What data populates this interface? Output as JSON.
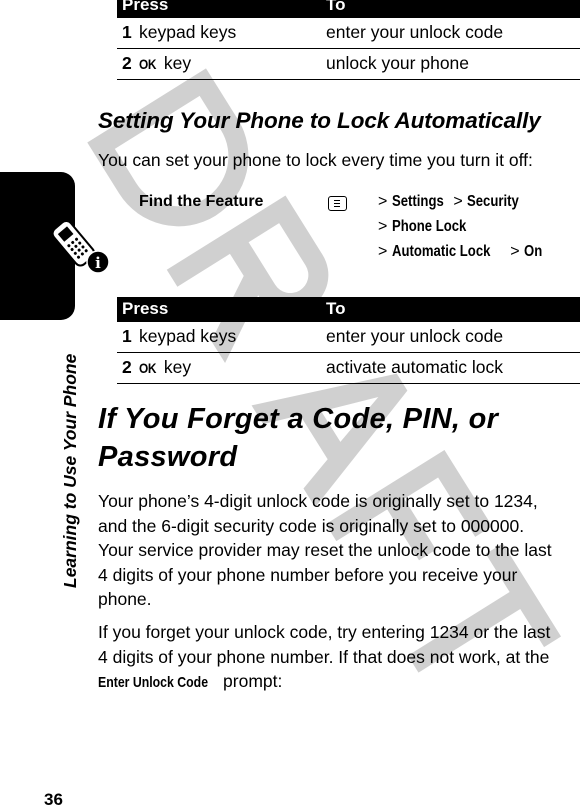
{
  "page": {
    "number": "36",
    "side_tab_label": "Learning to Use Your Phone",
    "side_tab_icon": "phone-info-icon",
    "watermark": "DRAFT"
  },
  "table1": {
    "headers": [
      "Press",
      "To"
    ],
    "rows": [
      {
        "num": "1",
        "key": "",
        "press": "keypad keys",
        "to": "enter your unlock code"
      },
      {
        "num": "2",
        "key": "OK",
        "press": " key",
        "to": "unlock your phone"
      }
    ]
  },
  "section1": {
    "title": "Setting Your Phone to Lock Automatically",
    "intro": "You can set your phone to lock every time you turn it off:",
    "find_feature": {
      "label": "Find the Feature",
      "icon": "menu-key-icon",
      "path": [
        [
          "Settings",
          "Security"
        ],
        [
          "Phone Lock"
        ],
        [
          "Automatic Lock",
          "On"
        ]
      ],
      "separator": ">"
    }
  },
  "table2": {
    "headers": [
      "Press",
      "To"
    ],
    "rows": [
      {
        "num": "1",
        "key": "",
        "press": "keypad keys",
        "to": "enter your unlock code"
      },
      {
        "num": "2",
        "key": "OK",
        "press": " key",
        "to": "activate automatic lock"
      }
    ]
  },
  "section2": {
    "title_line1": "If You Forget a Code, PIN, or",
    "title_line2": "Password",
    "para1_lines": [
      "Your phone’s 4-digit unlock code is originally set to 1234,",
      "and the 6-digit security code is originally set to 000000.",
      "Your service provider may reset the unlock code to the last",
      "4 digits of your phone number before you receive your",
      "phone."
    ],
    "para2_lines": [
      "If you forget your unlock code, try entering 1234 or the last",
      "4 digits of your phone number. If that does not work, at the"
    ],
    "para2_prompt_name": "Enter Unlock Code",
    "para2_tail": " prompt:"
  }
}
